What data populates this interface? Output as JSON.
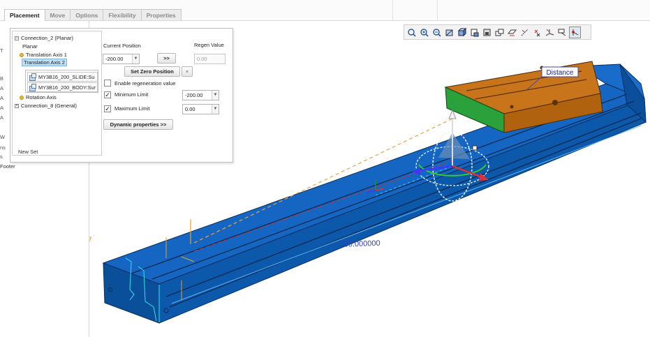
{
  "tabs": [
    {
      "label": "Placement",
      "active": true
    },
    {
      "label": "Move",
      "active": false
    },
    {
      "label": "Options",
      "active": false
    },
    {
      "label": "Flexibility",
      "active": false
    },
    {
      "label": "Properties",
      "active": false
    }
  ],
  "left_strip": {
    "letters": [
      "T",
      "B",
      "A",
      "A",
      "A",
      "A",
      "W",
      "ns",
      "s"
    ],
    "footer": "Footer"
  },
  "tree": {
    "connection_2": "Connection_2 (Planar)",
    "planar": "Planar",
    "translation_axis_1": "Translation Axis 1",
    "translation_axis_2": "Translation Axis 2",
    "ref_1": "MY3B16_200_SLIDE:Su",
    "ref_2": "MY3B16_200_BODY:Sur",
    "rotation_axis": "Rotation Axis",
    "connection_8": "Connection_8 (General)",
    "new_set": "New Set"
  },
  "placement": {
    "current_position_label": "Current Position",
    "current_position_value": "-200.00",
    "regen_value_label": "Regen Value",
    "regen_value": "0.00",
    "apply_button": ">>",
    "set_zero_button": "Set Zero Position",
    "enable_regen_label": "Enable regeneration value",
    "enable_regen_checked": false,
    "min_limit_label": "Minimum Limit",
    "min_limit_checked": true,
    "min_limit_value": "-200.00",
    "max_limit_label": "Maximum Limit",
    "max_limit_checked": true,
    "max_limit_value": "0.00",
    "dynamic_button": "Dynamic properties >>"
  },
  "toolbar": {
    "icons": [
      "refit-icon",
      "zoom-in-icon",
      "zoom-out-icon",
      "repaint-icon",
      "display-style-icon",
      "saved-orientations-icon",
      "view-manager-icon",
      "datum-display-icon",
      "plane-display-icon",
      "axis-display-icon",
      "point-display-icon",
      "csys-display-icon",
      "annotation-display-icon",
      "spin-center-icon"
    ],
    "active_icon": "spin-center-icon"
  },
  "viewport": {
    "distance_label": "Distance",
    "dimension_text": "-200.000000",
    "colors": {
      "body": "#0d5fb3",
      "slide": "#c7741a",
      "slide_side": "#2aa13a",
      "dragger_x": "#e23030",
      "dragger_y": "#2b8a2b",
      "dragger_z": "#3a3aff"
    }
  }
}
